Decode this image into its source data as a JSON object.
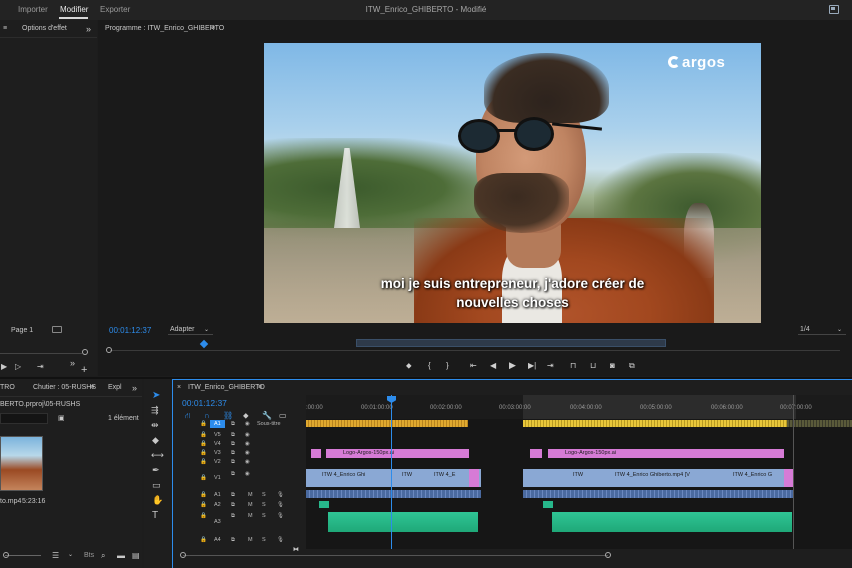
{
  "menubar": {
    "items": [
      {
        "label": "Importer",
        "active": false
      },
      {
        "label": "Modifier",
        "active": true
      },
      {
        "label": "Exporter",
        "active": false
      }
    ],
    "title": "ITW_Enrico_GHIBERTO",
    "title_suffix": " - Modifié"
  },
  "effects_panel": {
    "menu_icon": "hamburger-icon",
    "tab": "Options d'effet",
    "expand_icon": "double-chevron-icon",
    "page_label": "Page 1"
  },
  "program_monitor": {
    "title": "Programme : ITW_Enrico_GHIBERTO",
    "timecode": "00:01:12:37",
    "fit": "Adapter",
    "quality": "1/4",
    "subtitle_line1": "moi je suis entrepreneur, j'adore créer de",
    "subtitle_line2": "nouvelles choses",
    "logo_text": "argos"
  },
  "project_panel": {
    "tab1": "TRO",
    "tab2": "Chutier : 05-RUSHS",
    "tab3": "Expl",
    "path": "BERTO.prproj\\05-RUSHS",
    "count": "1 élément",
    "clip_name": "to.mp4",
    "clip_duration": "5:23:16",
    "footer_hint": "Bts"
  },
  "timeline": {
    "title": "ITW_Enrico_GHIBERTO",
    "timecode": "00:01:12:37",
    "ruler": [
      ":00:00",
      "00:01:00:00",
      "00:02:00:00",
      "00:03:00:00",
      "00:04:00:00",
      "00:05:00:00",
      "00:06:00:00",
      "00:07:00:00"
    ],
    "tracks": [
      {
        "name": "A1",
        "label": "Sous-titre",
        "kind": "caption"
      },
      {
        "name": "V5",
        "kind": "video"
      },
      {
        "name": "V4",
        "kind": "video"
      },
      {
        "name": "V3",
        "kind": "video"
      },
      {
        "name": "V2",
        "kind": "video"
      },
      {
        "name": "V1",
        "kind": "video"
      },
      {
        "name": "A1",
        "kind": "audio"
      },
      {
        "name": "A2",
        "kind": "audio"
      },
      {
        "name": "A3",
        "kind": "audio"
      },
      {
        "name": "A4",
        "kind": "audio"
      }
    ],
    "clips": {
      "logo1": "Logo-Argos-150px.ai",
      "logo2": "Logo-Argos-150px.ai",
      "v1a": "ITW 4_Enrico Ghi",
      "v1b": "ITW",
      "v1c": "ITW 4_E",
      "v1d": "ITW",
      "v1e": "ITW 4_Enrico Ghiberto.mp4 [V",
      "v1f": "ITW 4_Enrico G"
    },
    "track_buttons": {
      "mute": "M",
      "solo": "S"
    }
  },
  "tools": [
    "selection-tool-icon",
    "track-select-icon",
    "ripple-edit-icon",
    "razor-icon",
    "slip-icon",
    "pen-icon",
    "rectangle-icon",
    "hand-icon",
    "type-icon"
  ],
  "colors": {
    "accent": "#2d8ceb",
    "caption": "#e5b83a",
    "graphic": "#d67bd6",
    "video": "#8aa8d4",
    "audio": "#27b78b"
  }
}
